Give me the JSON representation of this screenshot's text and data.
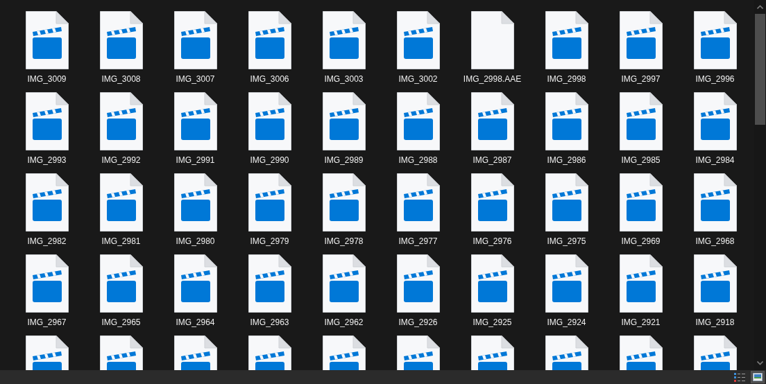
{
  "files": [
    {
      "kind": "video",
      "name": "IMG_3009"
    },
    {
      "kind": "video",
      "name": "IMG_3008"
    },
    {
      "kind": "video",
      "name": "IMG_3007"
    },
    {
      "kind": "video",
      "name": "IMG_3006"
    },
    {
      "kind": "video",
      "name": "IMG_3003"
    },
    {
      "kind": "video",
      "name": "IMG_3002"
    },
    {
      "kind": "blank",
      "name": "IMG_2998.AAE"
    },
    {
      "kind": "video",
      "name": "IMG_2998"
    },
    {
      "kind": "video",
      "name": "IMG_2997"
    },
    {
      "kind": "video",
      "name": "IMG_2996"
    },
    {
      "kind": "video",
      "name": "IMG_2993"
    },
    {
      "kind": "video",
      "name": "IMG_2992"
    },
    {
      "kind": "video",
      "name": "IMG_2991"
    },
    {
      "kind": "video",
      "name": "IMG_2990"
    },
    {
      "kind": "video",
      "name": "IMG_2989"
    },
    {
      "kind": "video",
      "name": "IMG_2988"
    },
    {
      "kind": "video",
      "name": "IMG_2987"
    },
    {
      "kind": "video",
      "name": "IMG_2986"
    },
    {
      "kind": "video",
      "name": "IMG_2985"
    },
    {
      "kind": "video",
      "name": "IMG_2984"
    },
    {
      "kind": "video",
      "name": "IMG_2982"
    },
    {
      "kind": "video",
      "name": "IMG_2981"
    },
    {
      "kind": "video",
      "name": "IMG_2980"
    },
    {
      "kind": "video",
      "name": "IMG_2979"
    },
    {
      "kind": "video",
      "name": "IMG_2978"
    },
    {
      "kind": "video",
      "name": "IMG_2977"
    },
    {
      "kind": "video",
      "name": "IMG_2976"
    },
    {
      "kind": "video",
      "name": "IMG_2975"
    },
    {
      "kind": "video",
      "name": "IMG_2969"
    },
    {
      "kind": "video",
      "name": "IMG_2968"
    },
    {
      "kind": "video",
      "name": "IMG_2967"
    },
    {
      "kind": "video",
      "name": "IMG_2965"
    },
    {
      "kind": "video",
      "name": "IMG_2964"
    },
    {
      "kind": "video",
      "name": "IMG_2963"
    },
    {
      "kind": "video",
      "name": "IMG_2962"
    },
    {
      "kind": "video",
      "name": "IMG_2926"
    },
    {
      "kind": "video",
      "name": "IMG_2925"
    },
    {
      "kind": "video",
      "name": "IMG_2924"
    },
    {
      "kind": "video",
      "name": "IMG_2921"
    },
    {
      "kind": "video",
      "name": "IMG_2918"
    },
    {
      "kind": "video"
    },
    {
      "kind": "video"
    },
    {
      "kind": "video"
    },
    {
      "kind": "video"
    },
    {
      "kind": "video"
    },
    {
      "kind": "video"
    },
    {
      "kind": "video"
    },
    {
      "kind": "video"
    },
    {
      "kind": "video"
    },
    {
      "kind": "video"
    }
  ],
  "views": [
    {
      "kind": "details",
      "selected": false
    },
    {
      "kind": "large-icons",
      "selected": true
    }
  ]
}
